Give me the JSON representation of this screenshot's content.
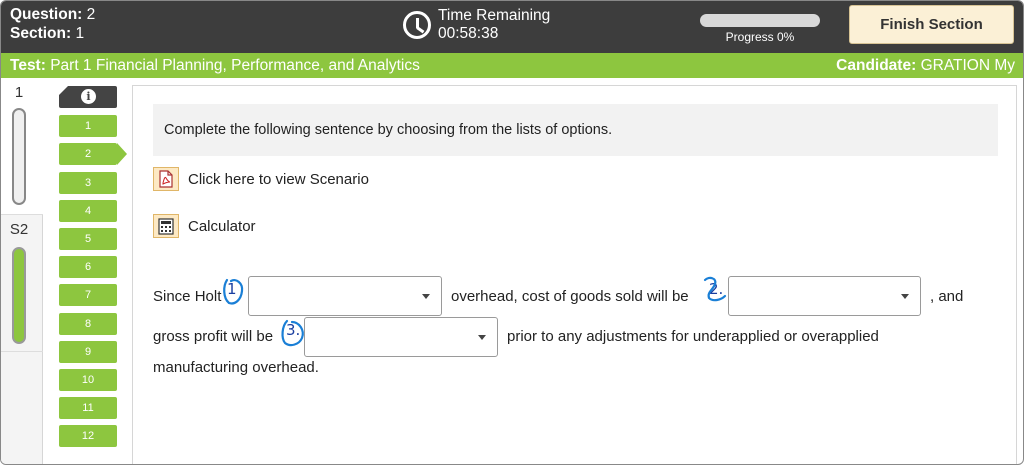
{
  "header": {
    "question_label": "Question:",
    "question_value": "2",
    "section_label": "Section:",
    "section_value": "1",
    "time_title": "Time Remaining",
    "time_value": "00:58:38",
    "progress_label": "Progress 0%",
    "progress_fraction": 0,
    "finish_label": "Finish Section"
  },
  "testbar": {
    "test_label": "Test:",
    "test_name": "Part 1 Financial Planning, Performance, and Analytics",
    "candidate_label": "Candidate:",
    "candidate_name": "GRATION My"
  },
  "sections": [
    {
      "label": "1"
    },
    {
      "label": "S2"
    }
  ],
  "question_nav": {
    "info_icon": "info-icon",
    "current": "2",
    "items": [
      "1",
      "2",
      "3",
      "4",
      "5",
      "6",
      "7",
      "8",
      "9",
      "10",
      "11",
      "12"
    ]
  },
  "content": {
    "instruction": "Complete the following sentence by choosing from the lists of options.",
    "scenario_link": "Click here to view Scenario",
    "calculator_link": "Calculator",
    "sentence": {
      "part1": "Since Holt",
      "part2": "overhead, cost of goods sold will be",
      "part3": ", and",
      "part4": "gross profit will be",
      "part5": "prior to any adjustments for underapplied or overapplied",
      "part6": "manufacturing overhead."
    },
    "dropdowns": [
      {
        "value": ""
      },
      {
        "value": ""
      },
      {
        "value": ""
      }
    ],
    "annotations": [
      "1",
      "2.",
      "3."
    ]
  },
  "colors": {
    "header_bg": "#3d3d3d",
    "accent_green": "#8dc63f",
    "finish_bg": "#fbf0d6",
    "annotation_ink": "#1a3fa0"
  }
}
